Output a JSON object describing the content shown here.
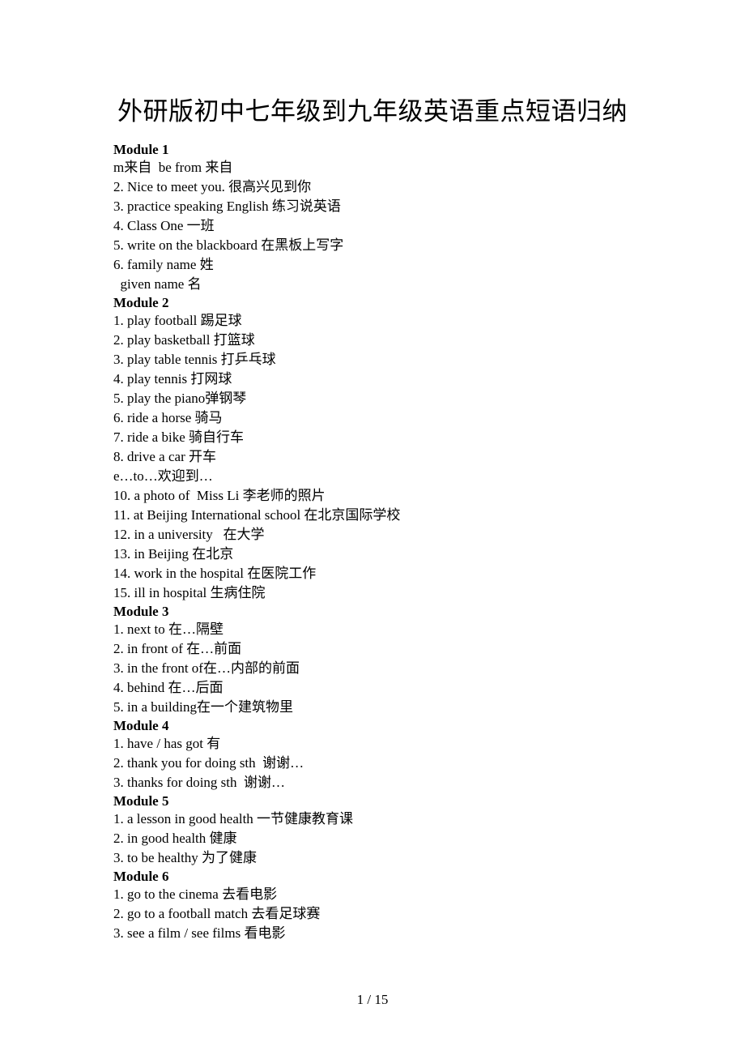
{
  "document": {
    "title": "外研版初中七年级到九年级英语重点短语归纳",
    "modules": [
      {
        "heading": "Module 1",
        "lines": [
          "m来自  be from 来自",
          "2. Nice to meet you. 很高兴见到你",
          "3. practice speaking English 练习说英语",
          "4. Class One 一班",
          "5. write on the blackboard 在黑板上写字",
          "6. family name 姓",
          "  given name 名"
        ]
      },
      {
        "heading": "Module 2",
        "lines": [
          "1. play football 踢足球",
          "2. play basketball 打篮球",
          "3. play table tennis 打乒乓球",
          "4. play tennis 打网球",
          "5. play the piano弹钢琴",
          "6. ride a horse 骑马",
          "7. ride a bike 骑自行车",
          "8. drive a car 开车",
          "e…to…欢迎到…",
          "10. a photo of  Miss Li 李老师的照片",
          "11. at Beijing International school 在北京国际学校",
          "12. in a university   在大学",
          "13. in Beijing 在北京",
          "14. work in the hospital 在医院工作",
          "15. ill in hospital 生病住院"
        ]
      },
      {
        "heading": "Module 3",
        "lines": [
          "1. next to 在…隔壁",
          "2. in front of 在…前面",
          "3. in the front of在…内部的前面",
          "4. behind 在…后面",
          "5. in a building在一个建筑物里"
        ]
      },
      {
        "heading": "Module 4",
        "lines": [
          "1. have / has got 有",
          "2. thank you for doing sth  谢谢…",
          "3. thanks for doing sth  谢谢…"
        ]
      },
      {
        "heading": "Module 5",
        "lines": [
          "1. a lesson in good health 一节健康教育课",
          "2. in good health 健康",
          "3. to be healthy 为了健康"
        ]
      },
      {
        "heading": "Module 6",
        "lines": [
          "1. go to the cinema 去看电影",
          "2. go to a football match 去看足球赛",
          "3. see a film / see films 看电影"
        ]
      }
    ],
    "page_indicator": "1 / 15"
  }
}
